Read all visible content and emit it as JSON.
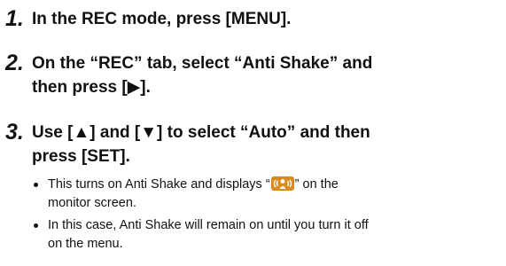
{
  "steps": [
    {
      "num": "1.",
      "text": "In the REC mode, press [MENU]."
    },
    {
      "num": "2.",
      "line1": "On the “REC” tab, select “Anti Shake” and",
      "line2": "then press [▶]."
    },
    {
      "num": "3.",
      "line1": "Use [▲] and [▼] to select “Auto” and then",
      "line2": "press [SET]."
    }
  ],
  "bullets": {
    "b1_before": "This turns on Anti Shake and displays “",
    "b1_after": "” on the",
    "b1_line2": "monitor screen.",
    "b2_line1": "In this case, Anti Shake will remain on until you turn it off",
    "b2_line2": "on the menu."
  },
  "icons": {
    "anti_shake": "anti-shake-icon",
    "accent_color": "#d98a1e"
  }
}
